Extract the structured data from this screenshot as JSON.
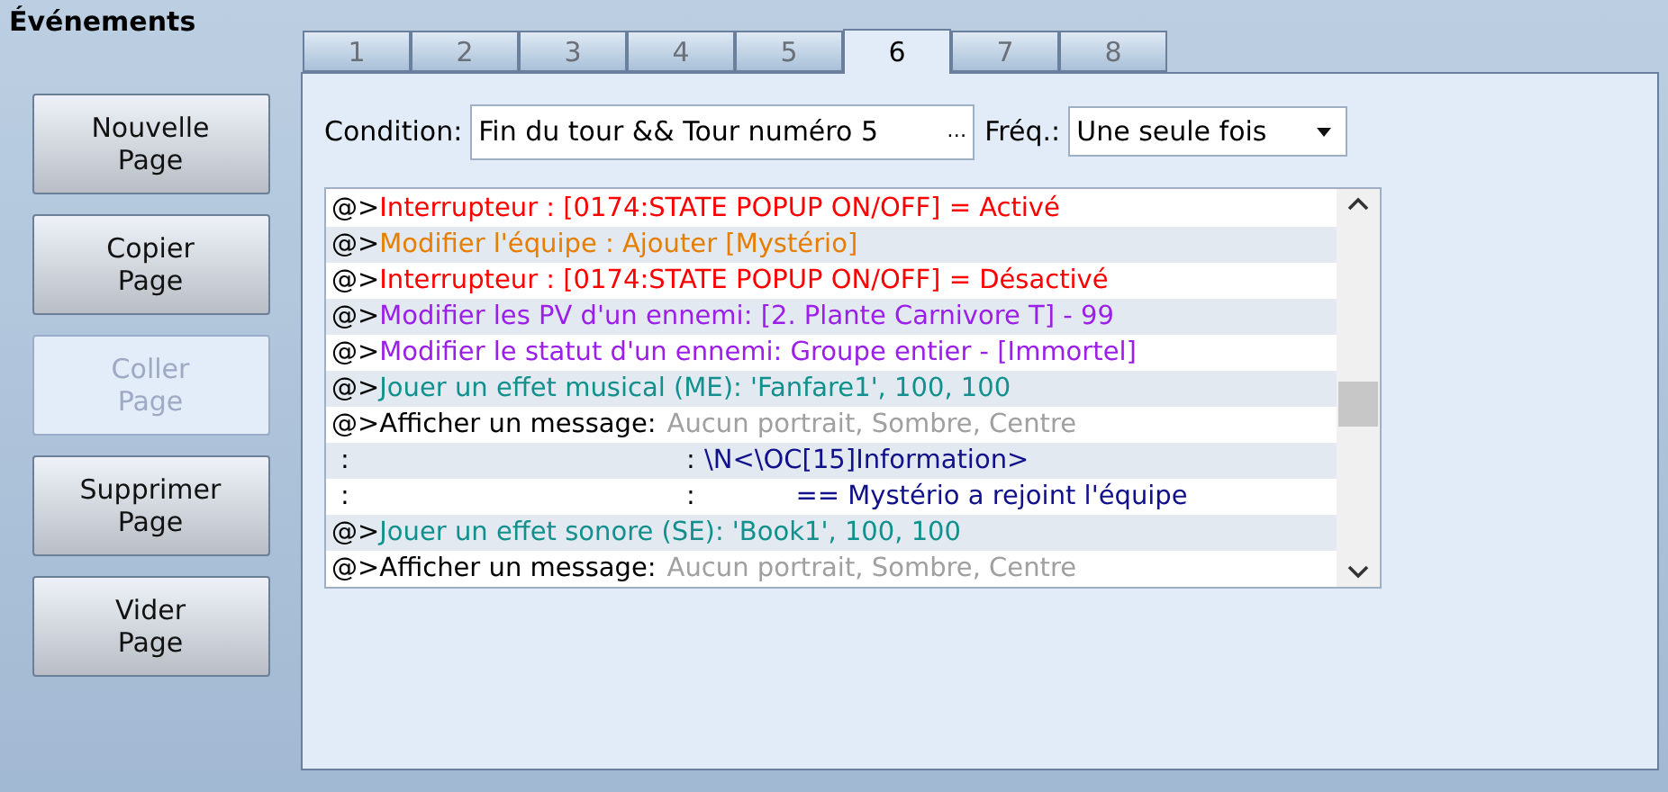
{
  "title": "Événements",
  "buttons": [
    {
      "label": "Nouvelle\nPage",
      "disabled": false
    },
    {
      "label": "Copier\nPage",
      "disabled": false
    },
    {
      "label": "Coller\nPage",
      "disabled": true
    },
    {
      "label": "Supprimer\nPage",
      "disabled": false
    },
    {
      "label": "Vider\nPage",
      "disabled": false
    }
  ],
  "tabs": [
    {
      "label": "1",
      "selected": false
    },
    {
      "label": "2",
      "selected": false
    },
    {
      "label": "3",
      "selected": false
    },
    {
      "label": "4",
      "selected": false
    },
    {
      "label": "5",
      "selected": false
    },
    {
      "label": "6",
      "selected": true
    },
    {
      "label": "7",
      "selected": false
    },
    {
      "label": "8",
      "selected": false
    }
  ],
  "condition": {
    "label": "Condition:",
    "value": "Fin du tour && Tour numéro 5",
    "button": "…"
  },
  "frequency": {
    "label": "Fréq.:",
    "value": "Une seule fois"
  },
  "commands": [
    {
      "kind": "command",
      "prefix": "@>",
      "parts": [
        {
          "kind": "switch",
          "text": "Interrupteur : [0174:STATE POPUP ON/OFF] = Activé"
        }
      ]
    },
    {
      "kind": "command",
      "prefix": "@>",
      "parts": [
        {
          "kind": "party",
          "text": "Modifier l'équipe : Ajouter [Mystério]"
        }
      ]
    },
    {
      "kind": "command",
      "prefix": "@>",
      "parts": [
        {
          "kind": "switch",
          "text": "Interrupteur : [0174:STATE POPUP ON/OFF] = Désactivé"
        }
      ]
    },
    {
      "kind": "command",
      "prefix": "@>",
      "parts": [
        {
          "kind": "enemy",
          "text": "Modifier les PV d'un ennemi: [2. Plante Carnivore T] - 99"
        }
      ]
    },
    {
      "kind": "command",
      "prefix": "@>",
      "parts": [
        {
          "kind": "enemy",
          "text": "Modifier le statut d'un ennemi: Groupe entier - [Immortel]"
        }
      ]
    },
    {
      "kind": "command",
      "prefix": "@>",
      "parts": [
        {
          "kind": "audio",
          "text": "Jouer un effet musical (ME): 'Fanfare1', 100, 100"
        }
      ]
    },
    {
      "kind": "command",
      "prefix": "@>",
      "parts": [
        {
          "kind": "message",
          "text": "Afficher un message:"
        },
        {
          "kind": "param",
          "text": "Aucun portrait, Sombre, Centre"
        }
      ]
    },
    {
      "kind": "continuation",
      "prefix": ":",
      "separator": ":",
      "parts": [
        {
          "kind": "text",
          "text": "\\N<\\OC[15]Information>"
        }
      ]
    },
    {
      "kind": "continuation",
      "prefix": ":",
      "separator": ":",
      "parts": [
        {
          "kind": "text",
          "text": "           == Mystério a rejoint l'équipe"
        }
      ]
    },
    {
      "kind": "command",
      "prefix": "@>",
      "parts": [
        {
          "kind": "audio",
          "text": "Jouer un effet sonore (SE): 'Book1', 100, 100"
        }
      ]
    },
    {
      "kind": "command",
      "prefix": "@>",
      "parts": [
        {
          "kind": "message",
          "text": "Afficher un message:"
        },
        {
          "kind": "param",
          "text": "Aucun portrait, Sombre, Centre"
        }
      ]
    }
  ]
}
